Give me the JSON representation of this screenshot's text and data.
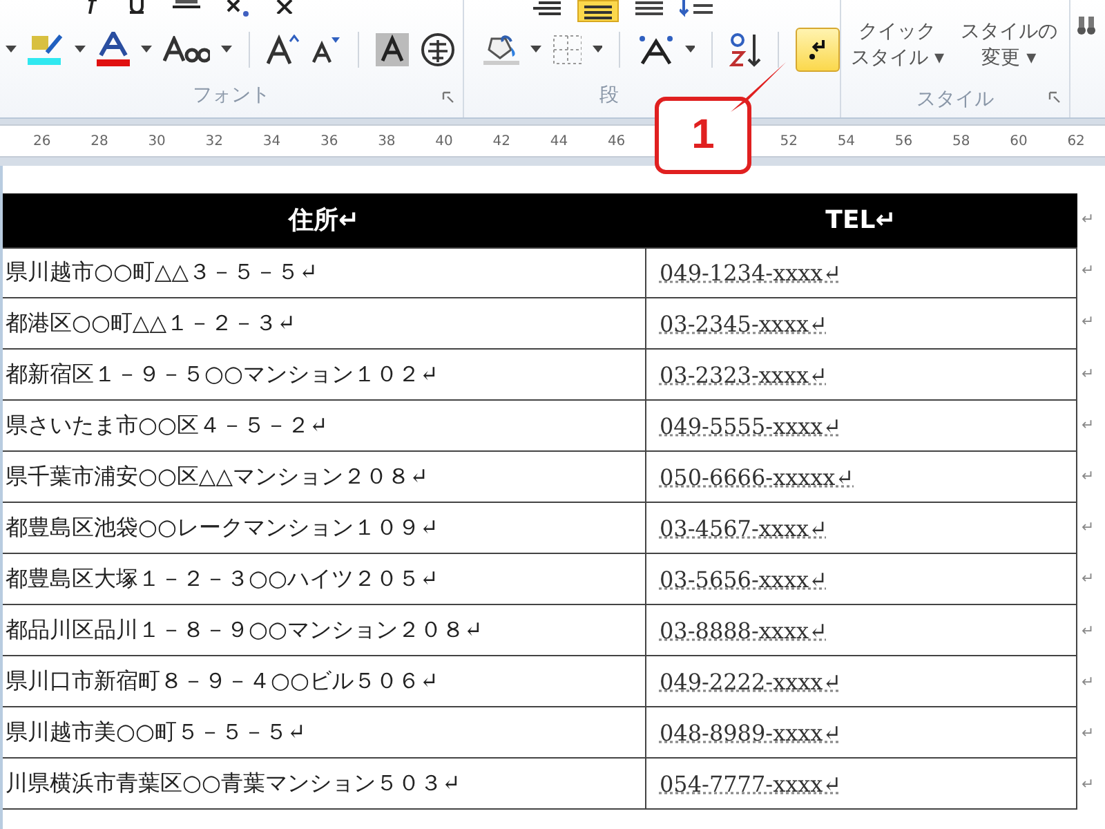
{
  "ribbon": {
    "groups": [
      {
        "kind": "font",
        "label": "フォント"
      },
      {
        "kind": "paragraph",
        "label": "段"
      },
      {
        "kind": "styles",
        "label": "スタイル",
        "buttons": [
          {
            "line1": "クイック",
            "line2": "スタイル ▾"
          },
          {
            "line1": "スタイルの",
            "line2": "変更 ▾"
          }
        ]
      }
    ],
    "show_marks_button": {
      "selected": true
    }
  },
  "callout": {
    "label": "1"
  },
  "ruler": [
    {
      "kind": "label",
      "text": "26"
    },
    {
      "kind": "label",
      "text": "28"
    },
    {
      "kind": "label",
      "text": "30"
    },
    {
      "kind": "label",
      "text": "32"
    },
    {
      "kind": "label",
      "text": "34"
    },
    {
      "kind": "label",
      "text": "36"
    },
    {
      "kind": "label",
      "text": "38"
    },
    {
      "kind": "label",
      "text": "40"
    },
    {
      "kind": "label",
      "text": "42"
    },
    {
      "kind": "label",
      "text": "44"
    },
    {
      "kind": "label",
      "text": "46"
    },
    {
      "kind": "covered"
    },
    {
      "kind": "covered"
    },
    {
      "kind": "label",
      "text": "52"
    },
    {
      "kind": "label",
      "text": "54"
    },
    {
      "kind": "label",
      "text": "56"
    },
    {
      "kind": "label",
      "text": "58"
    },
    {
      "kind": "label",
      "text": "60"
    },
    {
      "kind": "label",
      "text": "62"
    }
  ],
  "table": {
    "columns": [
      "住所↵",
      "TEL↵"
    ],
    "rows": [
      {
        "address": "県川越市○○町△△３－５－５↵",
        "tel": "049-1234-xxxx↵"
      },
      {
        "address": "都港区○○町△△１－２－３↵",
        "tel": "03-2345-xxxx↵"
      },
      {
        "address": "都新宿区１－９－５○○マンション１０２↵",
        "tel": "03-2323-xxxx↵"
      },
      {
        "address": "県さいたま市○○区４－５－２↵",
        "tel": "049-5555-xxxx↵"
      },
      {
        "address": "県千葉市浦安○○区△△マンション２０８↵",
        "tel": "050-6666-xxxxx↵"
      },
      {
        "address": "都豊島区池袋○○レークマンション１０９↵",
        "tel": "03-4567-xxxx↵"
      },
      {
        "address": "都豊島区大塚１－２－３○○ハイツ２０５↵",
        "tel": "03-5656-xxxx↵"
      },
      {
        "address": "都品川区品川１－８－９○○マンション２０８↵",
        "tel": "03-8888-xxxx↵"
      },
      {
        "address": "県川口市新宿町８－９－４○○ビル５０６↵",
        "tel": "049-2222-xxxx↵"
      },
      {
        "address": "県川越市美○○町５－５－５↵",
        "tel": "048-8989-xxxx↵"
      },
      {
        "address": "川県横浜市青葉区○○青葉マンション５０３↵",
        "tel": "054-7777-xxxx↵"
      }
    ],
    "row_end_mark": "↵"
  }
}
